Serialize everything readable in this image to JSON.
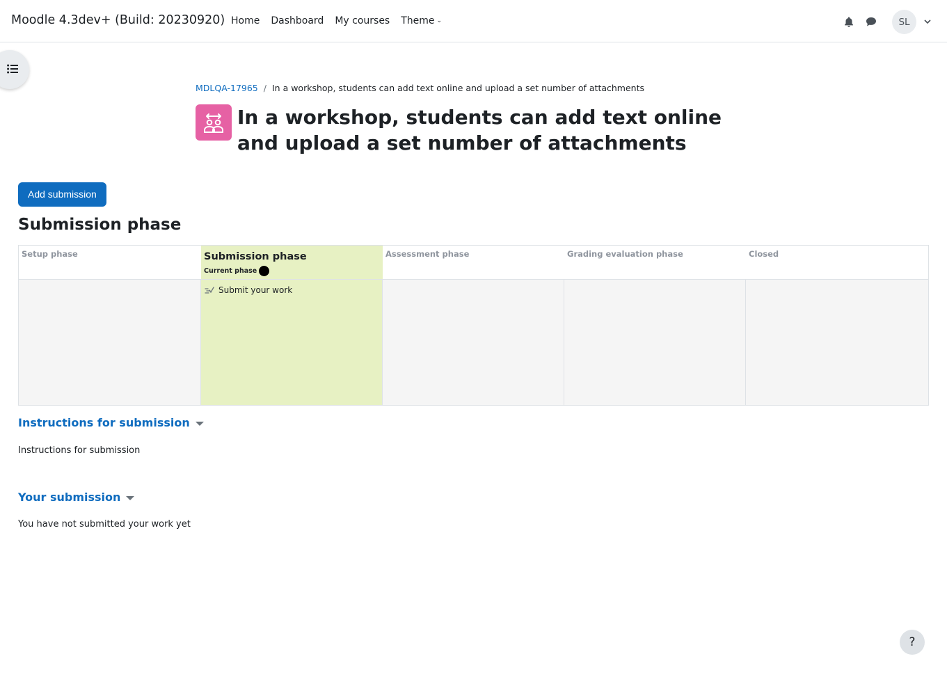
{
  "navbar": {
    "brand": "Moodle 4.3dev+ (Build: 20230920)",
    "links": [
      {
        "label": "Home"
      },
      {
        "label": "Dashboard"
      },
      {
        "label": "My courses"
      },
      {
        "label": "Theme"
      }
    ],
    "user_initials": "SL",
    "icons": [
      "bell-icon",
      "chat-icon",
      "chevron-down-icon"
    ]
  },
  "drawer": {
    "icon": "list-icon"
  },
  "breadcrumb": {
    "course": "MDLQA-17965",
    "separator": "/",
    "current": "In a workshop, students can add text online and upload a set number of attachments"
  },
  "page": {
    "title": "In a workshop, students can add text online and upload a set number of attachments",
    "activity_icon": "workshop-icon",
    "activity_icon_color": "#e661a4"
  },
  "actions": {
    "add_submission": "Add submission"
  },
  "phase_heading": "Submission phase",
  "planner": {
    "phases": [
      {
        "name": "Setup phase",
        "active": false
      },
      {
        "name": "Submission phase",
        "active": true,
        "current_label": "Current phase",
        "tasks": [
          "Submit your work"
        ]
      },
      {
        "name": "Assessment phase",
        "active": false
      },
      {
        "name": "Grading evaluation phase",
        "active": false
      },
      {
        "name": "Closed",
        "active": false
      }
    ],
    "active_color": "#e7f1c3"
  },
  "instructions": {
    "heading": "Instructions for submission",
    "text": "Instructions for submission"
  },
  "your_submission": {
    "heading": "Your submission",
    "text": "You have not submitted your work yet"
  },
  "help": {
    "label": "?"
  },
  "colors": {
    "primary": "#0f6cbf",
    "text": "#1d2125"
  }
}
